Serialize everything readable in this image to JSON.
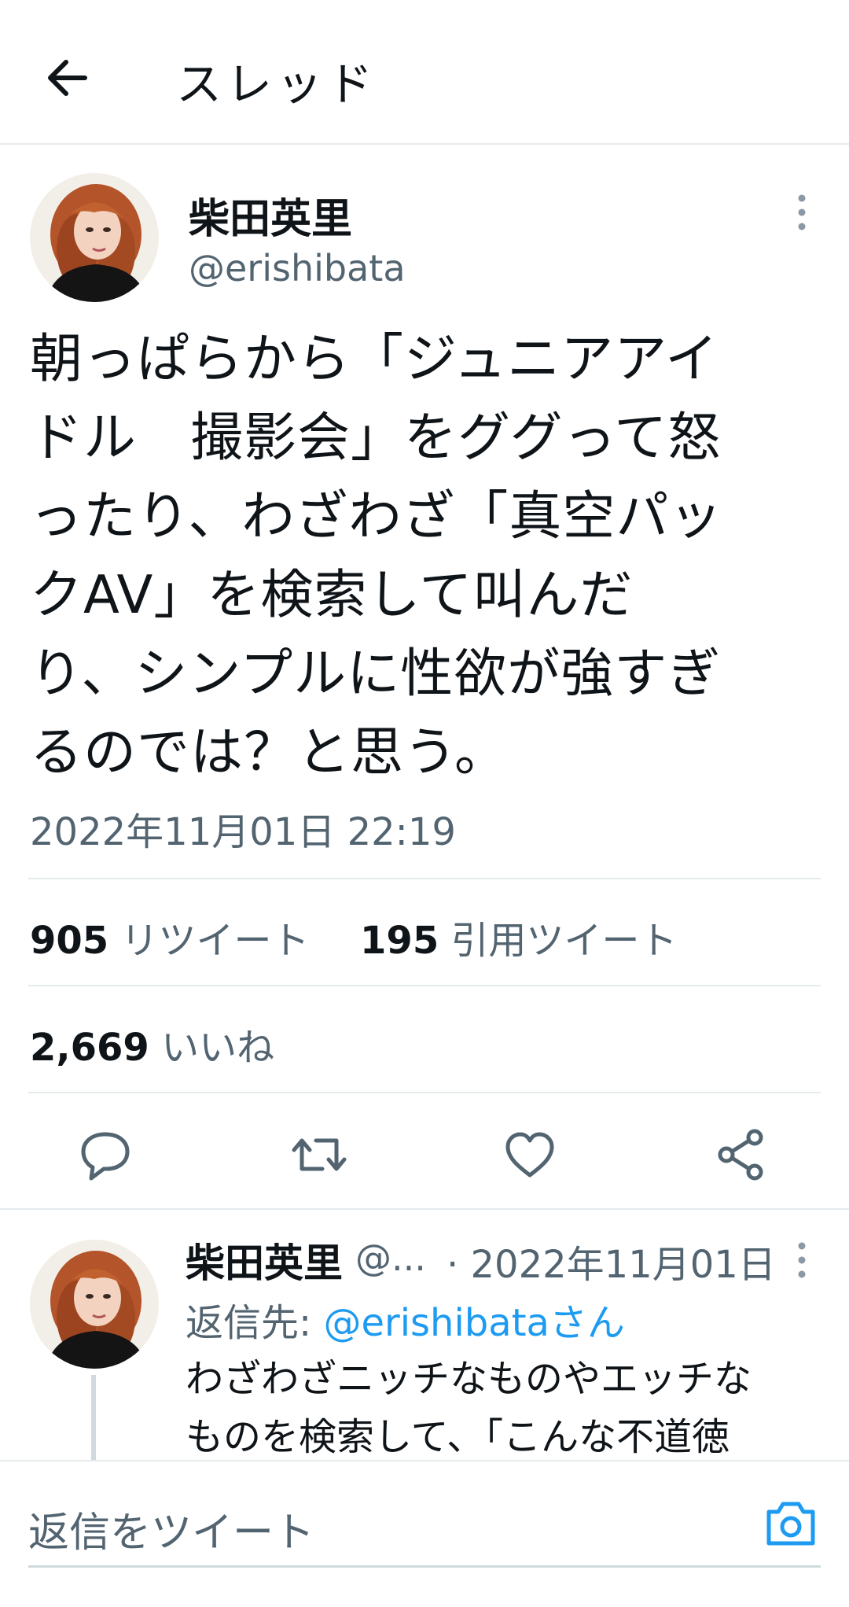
{
  "header": {
    "title": "スレッド",
    "back_icon": "arrow-left-icon"
  },
  "tweet": {
    "author_name": "柴田英里",
    "author_handle": "@erishibata",
    "text": "朝っぱらから「ジュニアアイ\nドル　撮影会」をググって怒\nったり、わざわざ「真空パッ\nクAV」を検索して叫んだ\nり、シンプルに性欲が強すぎ\nるのでは？と思う。",
    "timestamp": "2022年11月01日 22:19",
    "retweets_count": "905",
    "retweets_label": "リツイート",
    "quotes_count": "195",
    "quotes_label": "引用ツイート",
    "likes_count": "2,669",
    "likes_label": "いいね"
  },
  "actions": {
    "reply_icon": "reply-icon",
    "retweet_icon": "retweet-icon",
    "like_icon": "heart-icon",
    "share_icon": "share-icon"
  },
  "reply": {
    "author_name": "柴田英里",
    "author_handle": "@...",
    "date": "· 2022年11月01日",
    "reply_to_label": "返信先: ",
    "reply_to_mention": "@erishibataさん",
    "text": "わざわざニッチなものやエッチな\nものを検索して、「こんな不道徳"
  },
  "composer": {
    "placeholder": "返信をツイート",
    "camera_icon": "camera-icon"
  },
  "colors": {
    "accent": "#1d9bf0",
    "text_primary": "#0f1419",
    "text_secondary": "#536471",
    "divider": "#e6ebee"
  }
}
